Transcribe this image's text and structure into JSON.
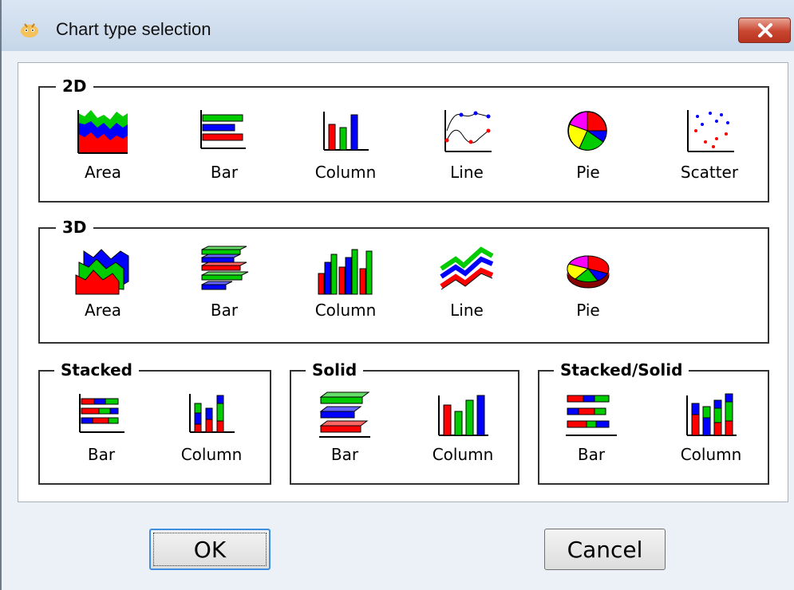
{
  "window": {
    "title": "Chart type selection"
  },
  "groups": {
    "g2d": {
      "title": "2D",
      "items": [
        "Area",
        "Bar",
        "Column",
        "Line",
        "Pie",
        "Scatter"
      ]
    },
    "g3d": {
      "title": "3D",
      "items": [
        "Area",
        "Bar",
        "Column",
        "Line",
        "Pie"
      ]
    },
    "stacked": {
      "title": "Stacked",
      "items": [
        "Bar",
        "Column"
      ]
    },
    "solid": {
      "title": "Solid",
      "items": [
        "Bar",
        "Column"
      ]
    },
    "stacked_solid": {
      "title": "Stacked/Solid",
      "items": [
        "Bar",
        "Column"
      ]
    }
  },
  "buttons": {
    "ok": "OK",
    "cancel": "Cancel"
  },
  "colors": {
    "red": "#ff0000",
    "green": "#00cc00",
    "blue": "#0000ff",
    "yellow": "#ffff00",
    "magenta": "#ff00ff"
  }
}
